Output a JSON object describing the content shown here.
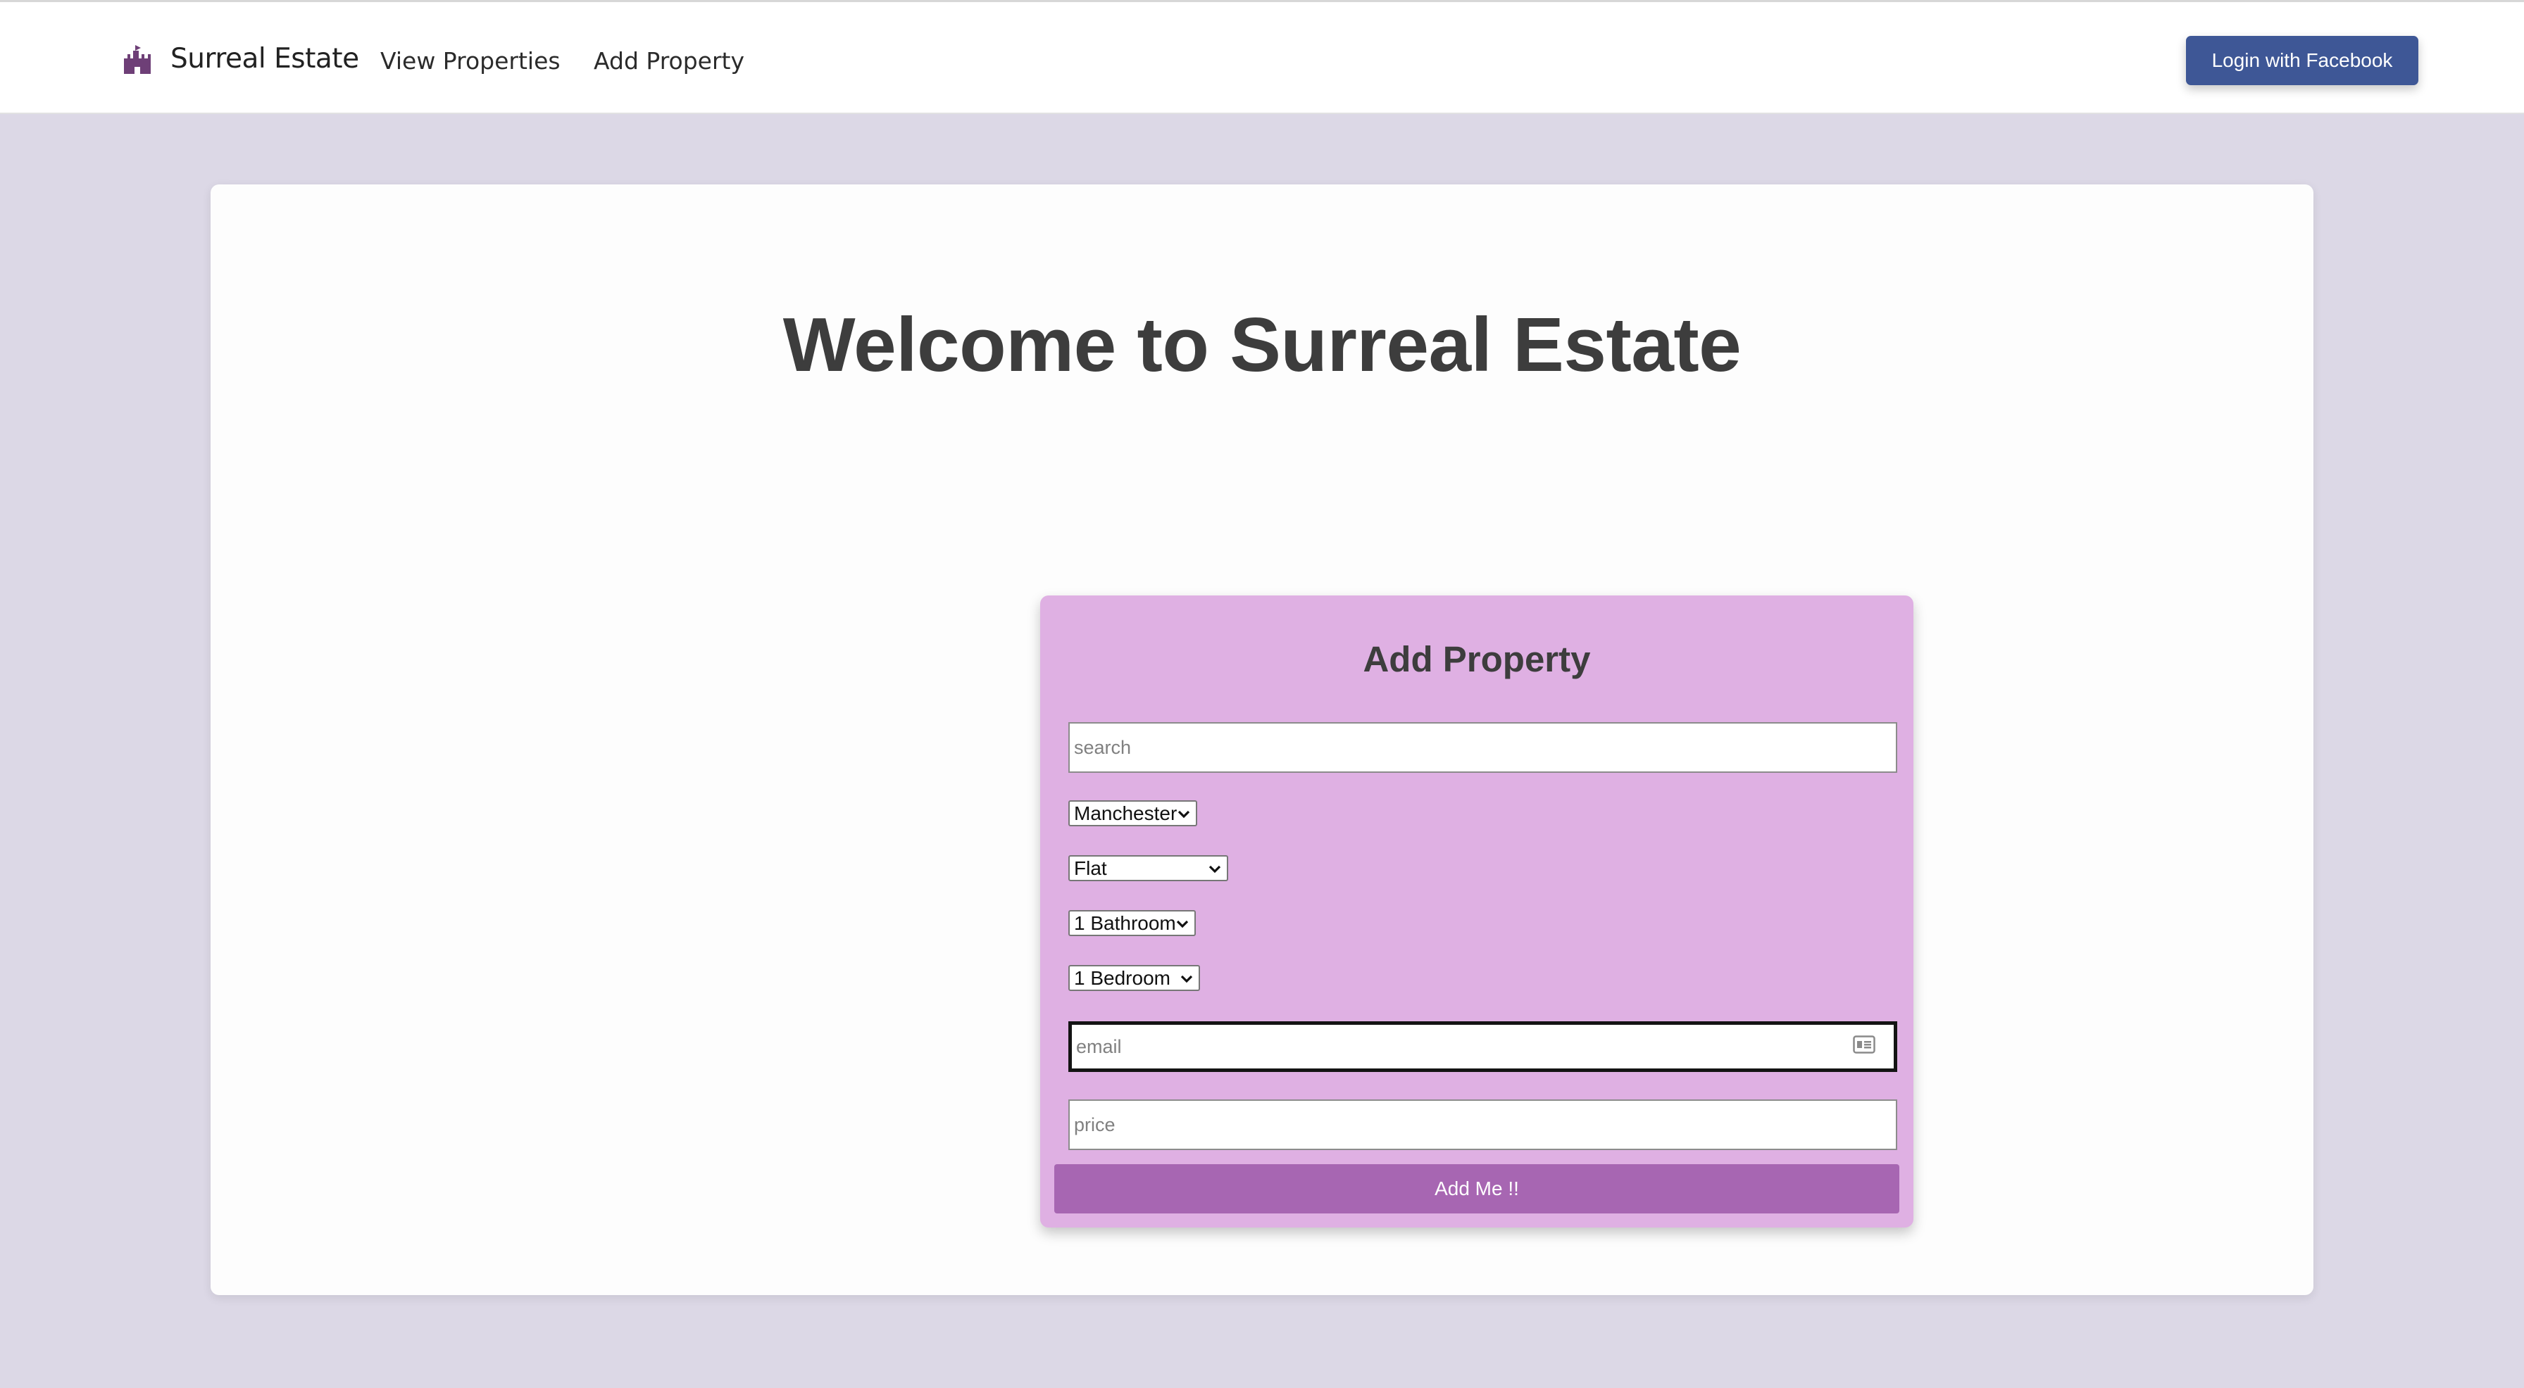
{
  "navbar": {
    "brand": "Surreal Estate",
    "links": [
      "View Properties",
      "Add Property"
    ],
    "login_button": "Login with Facebook"
  },
  "main": {
    "heading": "Welcome to Surreal Estate",
    "form": {
      "title": "Add Property",
      "search_placeholder": "search",
      "location": {
        "selected": "Manchester"
      },
      "type": {
        "selected": "Flat"
      },
      "bathrooms": {
        "selected": "1 Bathroom"
      },
      "bedrooms": {
        "selected": "1 Bedroom"
      },
      "email_placeholder": "email",
      "price_placeholder": "price",
      "submit_label": "Add Me !!"
    }
  },
  "colors": {
    "page_background": "#dcd8e6",
    "form_background": "#dfb0e3",
    "submit_button": "#a766b2",
    "facebook_button": "#3e5796",
    "brand_icon": "#6e3f77"
  },
  "icons": {
    "brand": "castle-icon",
    "email_field": "contact-card-icon",
    "select": "chevron-down-icon"
  }
}
